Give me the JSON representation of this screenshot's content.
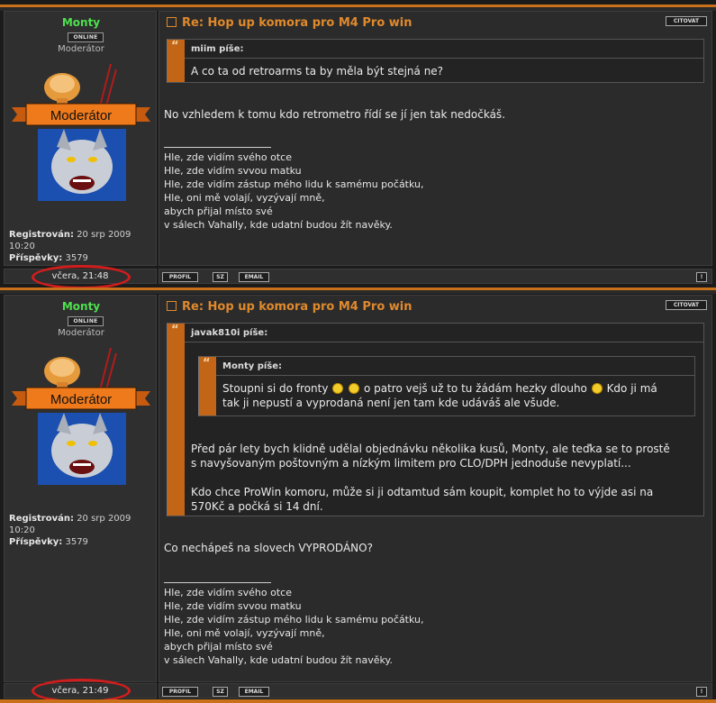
{
  "colors": {
    "accent": "#e0892c",
    "online_name": "#4ee04e",
    "quote_bar": "#c36516",
    "highlight_oval": "#d21d1d"
  },
  "author": {
    "username": "Monty",
    "online_label": "ONLINE",
    "rank": "Moderátor",
    "badge_text": "Moderátor",
    "registered_label": "Registrován:",
    "registered_value": "20 srp 2009",
    "registered_time": "10:20",
    "posts_label": "Příspěvky:",
    "posts_value": "3579"
  },
  "action_buttons": {
    "profile": "PROFIL",
    "pm": "SZ",
    "email": "EMAIL",
    "report": "!",
    "quote": "CITOVAT"
  },
  "posts": [
    {
      "title": "Re: Hop up komora pro M4 Pro win",
      "date": "včera, 21:48",
      "quote": {
        "author": "miim píše:",
        "text": "A co ta od retroarms ta by měla být stejná ne?"
      },
      "message": "No vzhledem k tomu kdo retrometro řídí se jí jen tak nedočkáš."
    },
    {
      "title": "Re: Hop up komora pro M4 Pro win",
      "date": "včera, 21:49",
      "quote": {
        "author": "javak810i píše:",
        "inner_author": "Monty píše:",
        "inner_line1_a": "Stoupni si do fronty",
        "inner_line1_b": "o patro vejš už to tu žádám hezky dlouho",
        "inner_line1_c": "Kdo ji má",
        "inner_line2": "tak ji nepustí a vyprodaná není jen tam kde udáváš ale všude.",
        "para1_line1": "Před pár lety bych klidně udělal objednávku několika kusů, Monty, ale teďka se to prostě",
        "para1_line2": "s navyšovaným poštovným a nízkým limitem pro CLO/DPH jednoduše nevyplatí...",
        "para2_line1": "Kdo chce ProWin komoru, může si ji odtamtud sám koupit, komplet ho to výjde asi na",
        "para2_line2": "570Kč a počká si 14 dní."
      },
      "message": "Co nechápeš na slovech VYPRODÁNO?"
    }
  ],
  "signature": [
    "Hle, zde vidím svého otce",
    "Hle, zde vidím svvou matku",
    "Hle, zde vidím zástup mého lidu k samému počátku,",
    "Hle, oni mě volají, vyzývají mně,",
    "abych přijal místo své",
    "v sálech Vahally, kde udatní budou žít navěky."
  ]
}
